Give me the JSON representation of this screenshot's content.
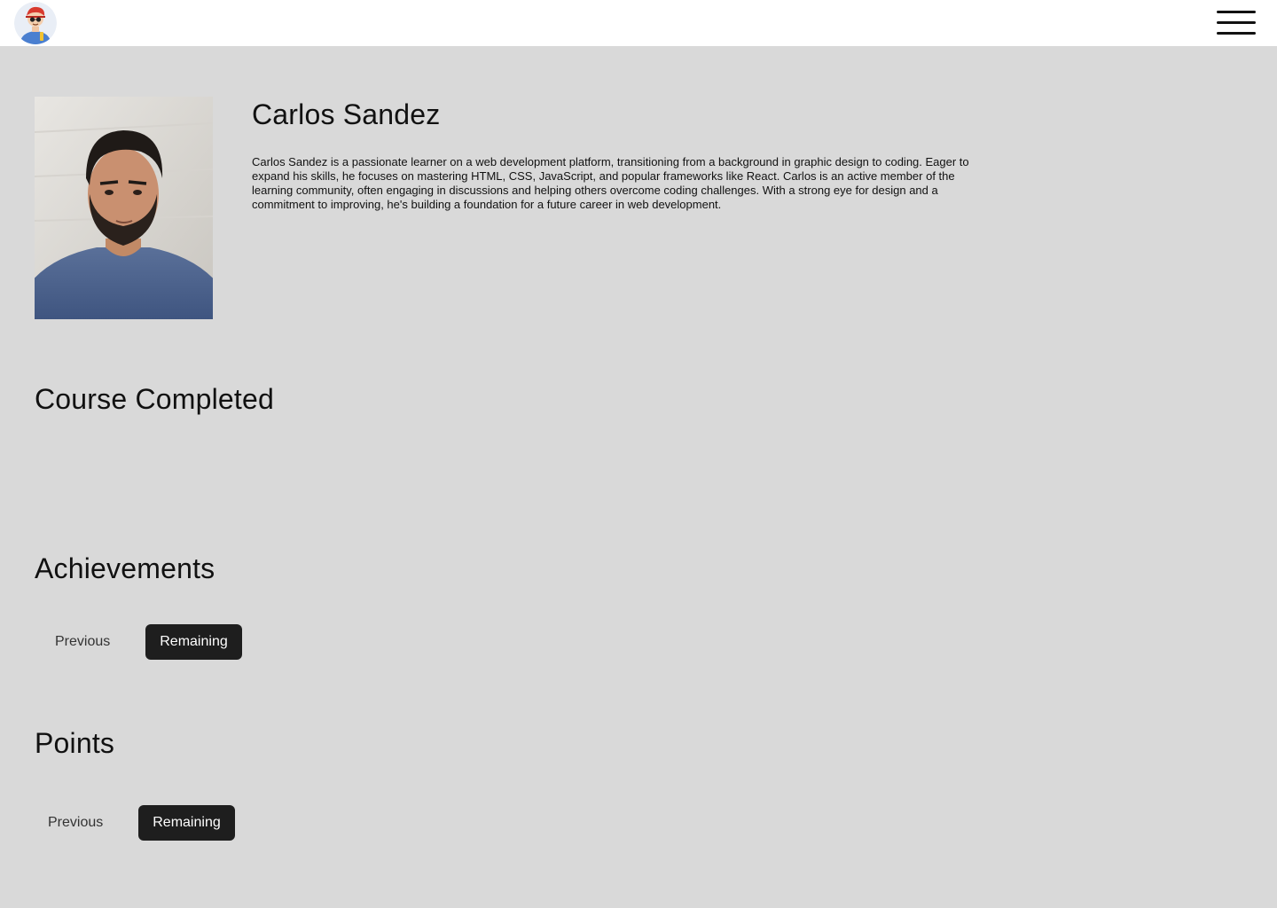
{
  "header": {
    "logo_icon": "avatar-mascot-icon",
    "menu_icon": "hamburger-menu-icon"
  },
  "profile": {
    "name": "Carlos Sandez",
    "bio": "Carlos Sandez is a passionate learner on a web development platform, transitioning from a background in graphic design to coding. Eager to expand his skills, he focuses on mastering HTML, CSS, JavaScript, and popular frameworks like React. Carlos is an active member of the learning community, often engaging in discussions and helping others overcome coding challenges. With a strong eye for design and a commitment to improving, he's building a foundation for a future career in web development.",
    "photo_icon": "profile-photo"
  },
  "courses": {
    "title": "Course Completed"
  },
  "achievements": {
    "title": "Achievements",
    "previous_label": "Previous",
    "remaining_label": "Remaining",
    "active": "Remaining"
  },
  "points": {
    "title": "Points",
    "previous_label": "Previous",
    "remaining_label": "Remaining",
    "active": "Remaining"
  },
  "colors": {
    "page_background": "#d9d9d9",
    "header_background": "#ffffff",
    "active_button": "#1e1e1e"
  }
}
